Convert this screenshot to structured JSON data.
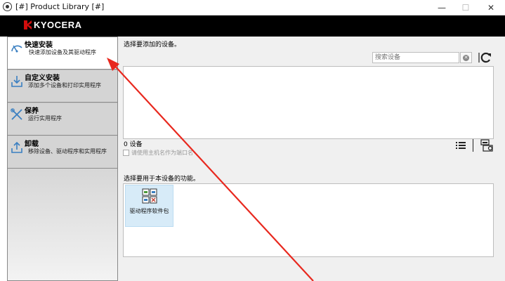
{
  "window": {
    "title": "[#] Product Library [#]",
    "minimize_glyph": "—",
    "maximize_glyph": "☐",
    "close_glyph": "✕"
  },
  "header": {
    "logo_text": "KYOCERA",
    "logo_color": "#d10d0d"
  },
  "sidebar": {
    "items": [
      {
        "title": "快速安装",
        "desc": "快速添加设备及其驱动程序",
        "icon": "speedometer-icon",
        "active": true
      },
      {
        "title": "自定义安装",
        "desc": "添加多个设备和打印实用程序",
        "icon": "custom-install-icon",
        "active": false
      },
      {
        "title": "保养",
        "desc": "运行实用程序",
        "icon": "tools-icon",
        "active": false
      },
      {
        "title": "卸载",
        "desc": "移除设备、驱动程序和实用程序",
        "icon": "uninstall-icon",
        "active": false
      }
    ]
  },
  "main": {
    "select_device_label": "选择要添加的设备。",
    "search_placeholder": "搜索设备",
    "device_count": "0 设备",
    "use_hostname_label": "请使用主机名作为端口名",
    "select_function_label": "选择要用于本设备的功能。",
    "functions": [
      {
        "label": "驱动程序软件包",
        "icon": "driver-package-icon",
        "selected": true
      }
    ]
  },
  "colors": {
    "accent": "#d10d0d",
    "selection": "#d7ebf8",
    "annotation_arrow": "#e8281e"
  }
}
